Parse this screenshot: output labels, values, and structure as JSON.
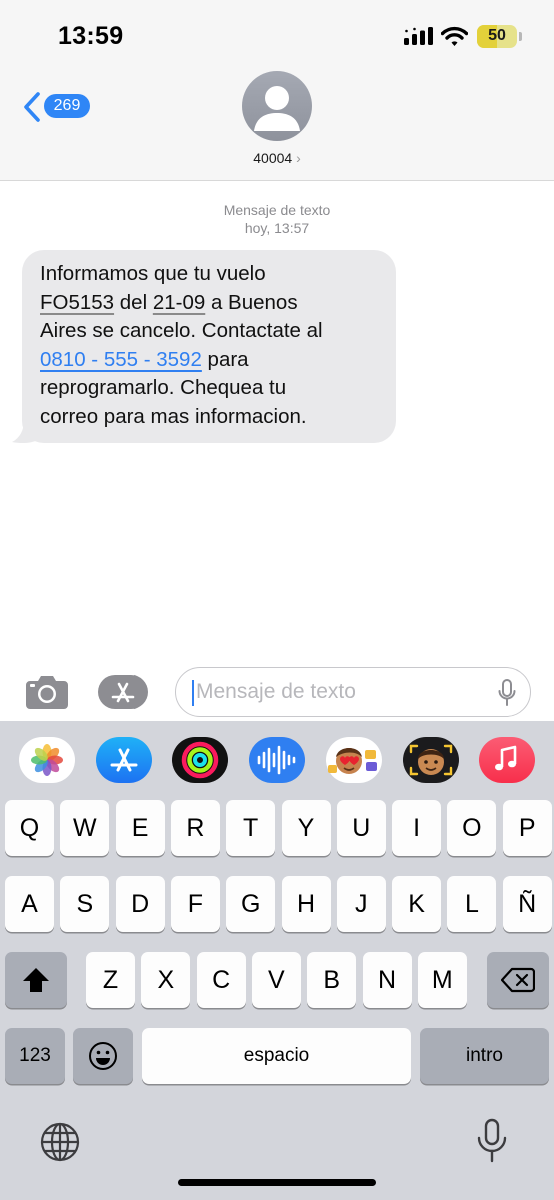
{
  "status_bar": {
    "time": "13:59",
    "battery_level": "50",
    "battery_fill_fraction": 0.5,
    "battery_color": "#e3d13a"
  },
  "header": {
    "back_badge_count": "269",
    "contact_name": "40004",
    "contact_chevron": "›",
    "accent_color": "#2f86f6"
  },
  "thread": {
    "meta_kind": "Mensaje de texto",
    "meta_time": "hoy, 13:57",
    "message": {
      "line1": "Informamos que tu vuelo",
      "flight": "FO5153",
      "del": " del ",
      "date": "21-09",
      "line2_rest": " a Buenos",
      "line3": "Aires se cancelo. Contactate al",
      "phone": "0810 - 555 - 3592",
      "line4_rest": " para",
      "line5": "reprogramarlo. Chequea tu",
      "line6": "correo para mas informacion."
    }
  },
  "compose": {
    "placeholder": "Mensaje de texto",
    "icons": [
      "camera-icon",
      "app-store-icon",
      "microphone-icon"
    ]
  },
  "keyboard": {
    "apps": [
      "photos-icon",
      "app-store-icon",
      "activity-icon",
      "audio-message-icon",
      "memoji-stickers-icon",
      "memoji-icon",
      "music-icon"
    ],
    "row1": [
      "Q",
      "W",
      "E",
      "R",
      "T",
      "Y",
      "U",
      "I",
      "O",
      "P"
    ],
    "row2": [
      "A",
      "S",
      "D",
      "F",
      "G",
      "H",
      "J",
      "K",
      "L",
      "Ñ"
    ],
    "row3": [
      "Z",
      "X",
      "C",
      "V",
      "B",
      "N",
      "M"
    ],
    "numbers_label": "123",
    "space_label": "espacio",
    "return_label": "intro"
  }
}
